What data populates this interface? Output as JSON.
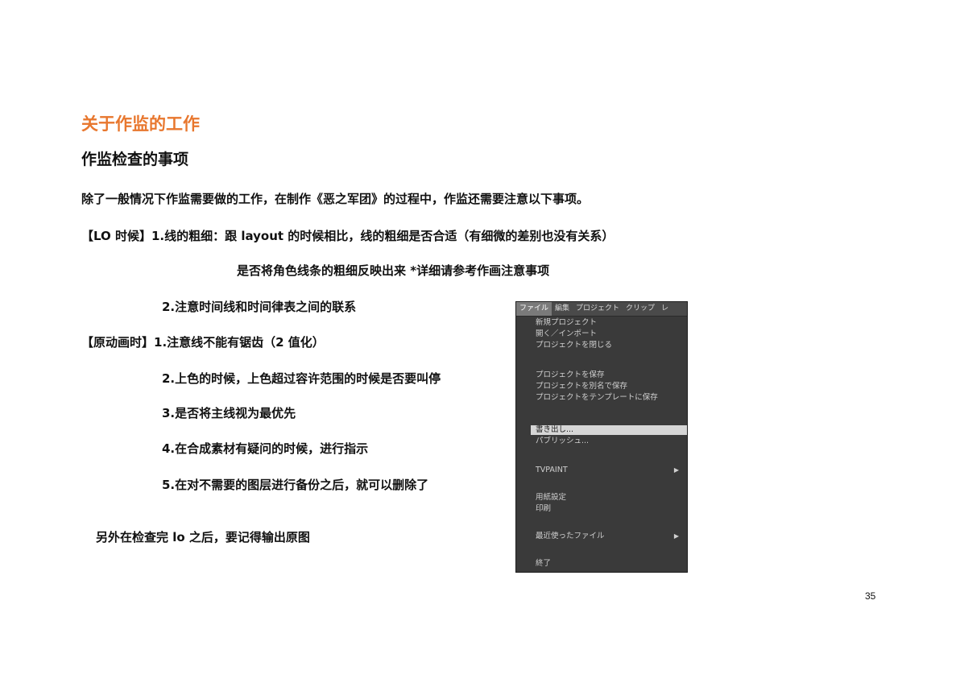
{
  "header": {
    "section_title": "关于作监的工作",
    "subsection_title": "作监检查的事项"
  },
  "content": {
    "intro": "除了一般情况下作监需要做的工作，在制作《恶之军团》的过程中，作监还需要注意以下事项。",
    "lo_item_1": "【LO 时候】1.线的粗细：跟 layout 的时候相比，线的粗细是否合适（有细微的差别也没有关系）",
    "lo_item_1_cont": "是否将角色线条的粗细反映出来  *详细请参考作画注意事项",
    "lo_item_2": "2.注意时间线和时间律表之间的联系",
    "genga_item_1": "【原动画时】1.注意线不能有锯齿（2 值化）",
    "genga_item_2": "2.上色的时候，上色超过容许范围的时候是否要叫停",
    "genga_item_3": "3.是否将主线视为最优先",
    "genga_item_4": "4.在合成素材有疑问的时候，进行指示",
    "genga_item_5": "5.在对不需要的图层进行备份之后，就可以删除了",
    "footer_note": "另外在检查完 lo 之后，要记得输出原图"
  },
  "menu_screenshot": {
    "menubar": [
      "ファイル",
      "編集",
      "プロジェクト",
      "クリップ",
      "レ"
    ],
    "items": [
      "新規プロジェクト",
      "開く／インポート",
      "プロジェクトを閉じる",
      "プロジェクトを保存",
      "プロジェクトを別名で保存",
      "プロジェクトをテンプレートに保存",
      "書き出し...",
      "パブリッシュ...",
      "TVPAINT",
      "用紙設定",
      "印刷",
      "最近使ったファイル",
      "終了"
    ]
  },
  "page": {
    "number": "35"
  },
  "colors": {
    "accent": "#e8772e",
    "text": "#111111",
    "menu_bg": "#3a3a3a"
  }
}
